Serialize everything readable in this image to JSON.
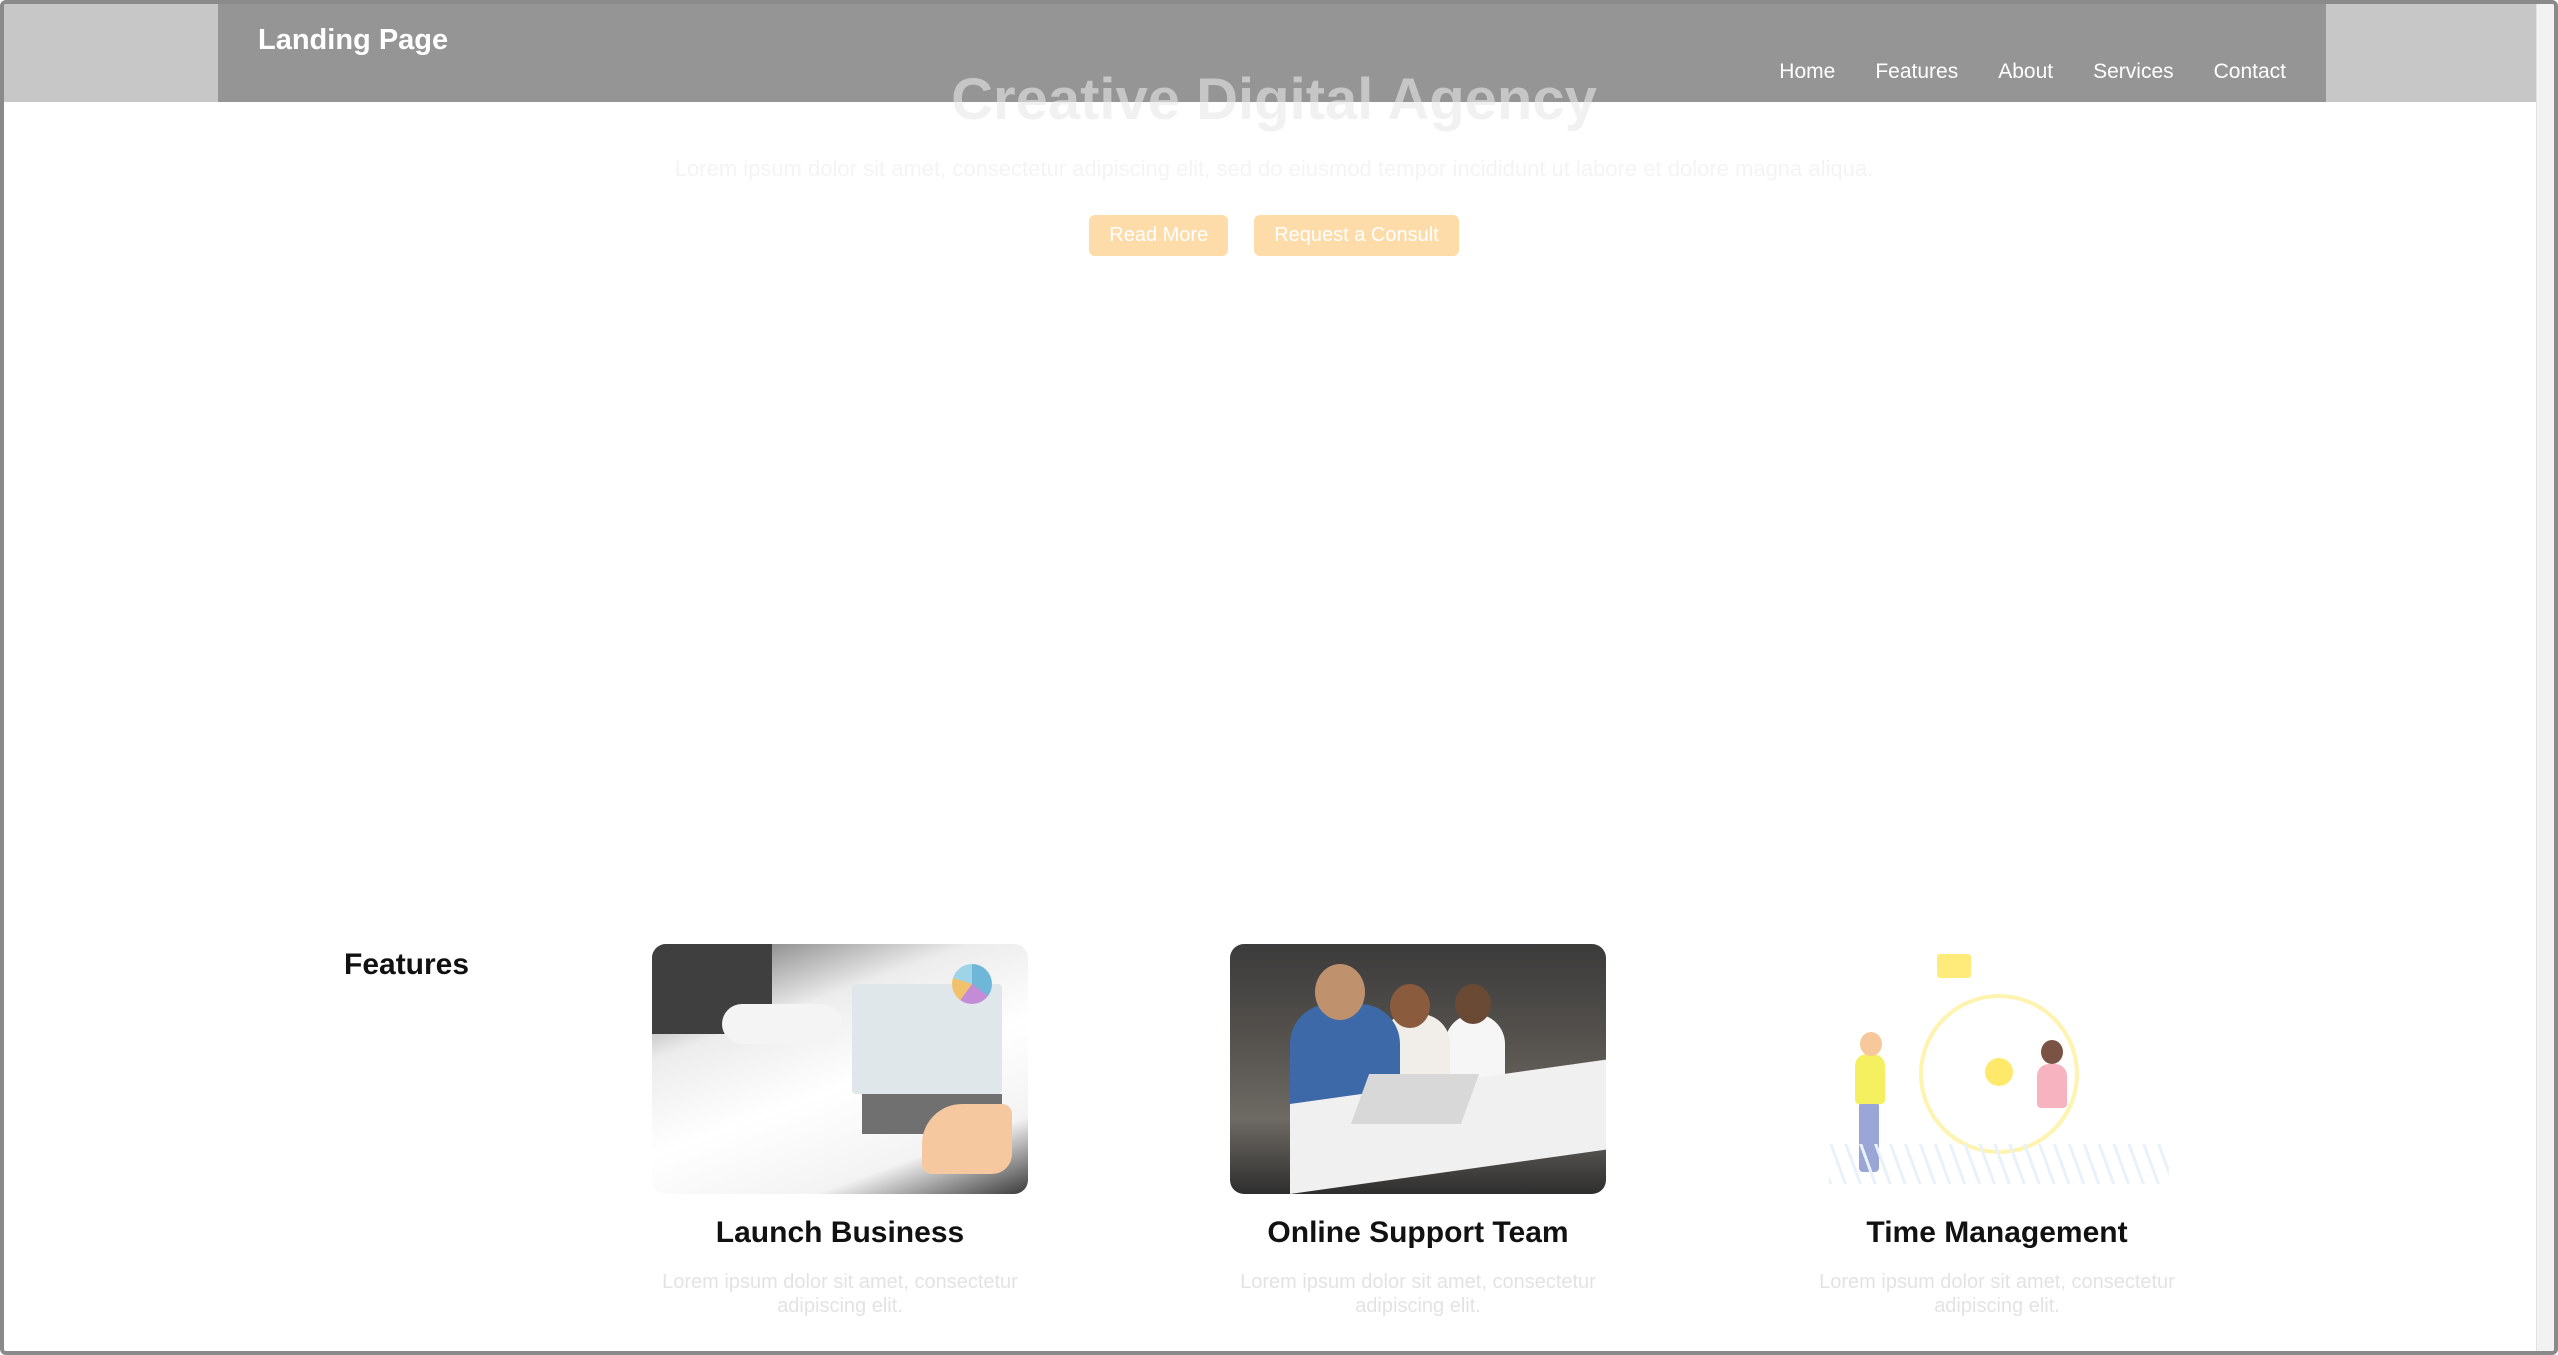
{
  "header": {
    "brand": "Landing Page",
    "nav": [
      "Home",
      "Features",
      "About",
      "Services",
      "Contact"
    ]
  },
  "hero": {
    "title": "Creative Digital Agency",
    "subtitle": "Lorem ipsum dolor sit amet, consectetur adipiscing elit, sed do eiusmod tempor incididunt ut labore et dolore magna aliqua.",
    "buttons": [
      "Read More",
      "Request a Consult"
    ]
  },
  "features": {
    "heading": "Features",
    "cards": [
      {
        "title": "Launch Business",
        "desc": "Lorem ipsum dolor sit amet, consectetur adipiscing elit.",
        "image": "office-desk-image"
      },
      {
        "title": "Online Support Team",
        "desc": "Lorem ipsum dolor sit amet, consectetur adipiscing elit.",
        "image": "support-team-image"
      },
      {
        "title": "Time Management",
        "desc": "Lorem ipsum dolor sit amet, consectetur adipiscing elit.",
        "image": "time-management-illustration"
      }
    ]
  },
  "colors": {
    "navbar": "#959595",
    "topbar": "#c7c7c7",
    "button": "#fddcaa"
  }
}
